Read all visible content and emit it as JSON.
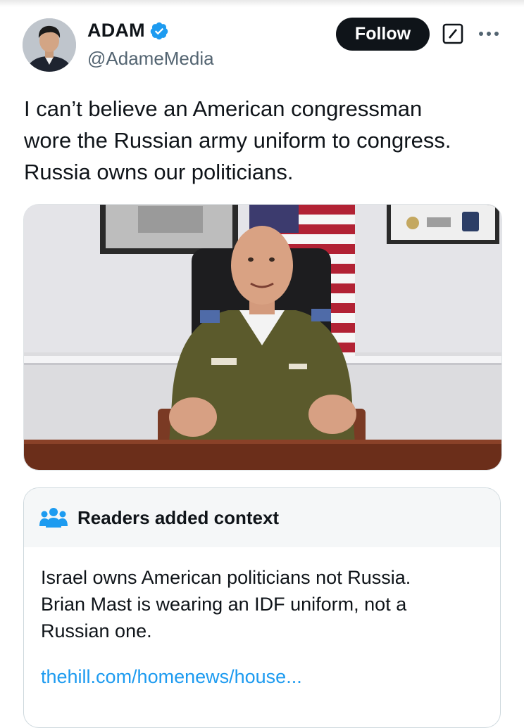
{
  "author": {
    "display_name": "ADAM",
    "handle": "@AdameMedia",
    "verified": true,
    "avatar_icon": "profile-photo"
  },
  "actions": {
    "follow_label": "Follow",
    "grok_icon": "grok-icon",
    "more_icon": "more-icon"
  },
  "tweet": {
    "lines": [
      "I can’t believe an American congressman",
      "wore the Russian army uniform to congress.",
      "Russia owns our politicians."
    ]
  },
  "media": {
    "description_icon": "photo"
  },
  "community_note": {
    "title": "Readers added context",
    "icon": "people-icon",
    "body_lines": [
      "Israel owns American politicians not Russia.",
      "Brian Mast is wearing an IDF uniform, not a",
      "Russian one."
    ],
    "link": "thehill.com/homenews/house..."
  },
  "colors": {
    "accent": "#1d9bf0",
    "text": "#0f1419",
    "secondary_text": "#536471",
    "follow_bg": "#0f1419"
  }
}
